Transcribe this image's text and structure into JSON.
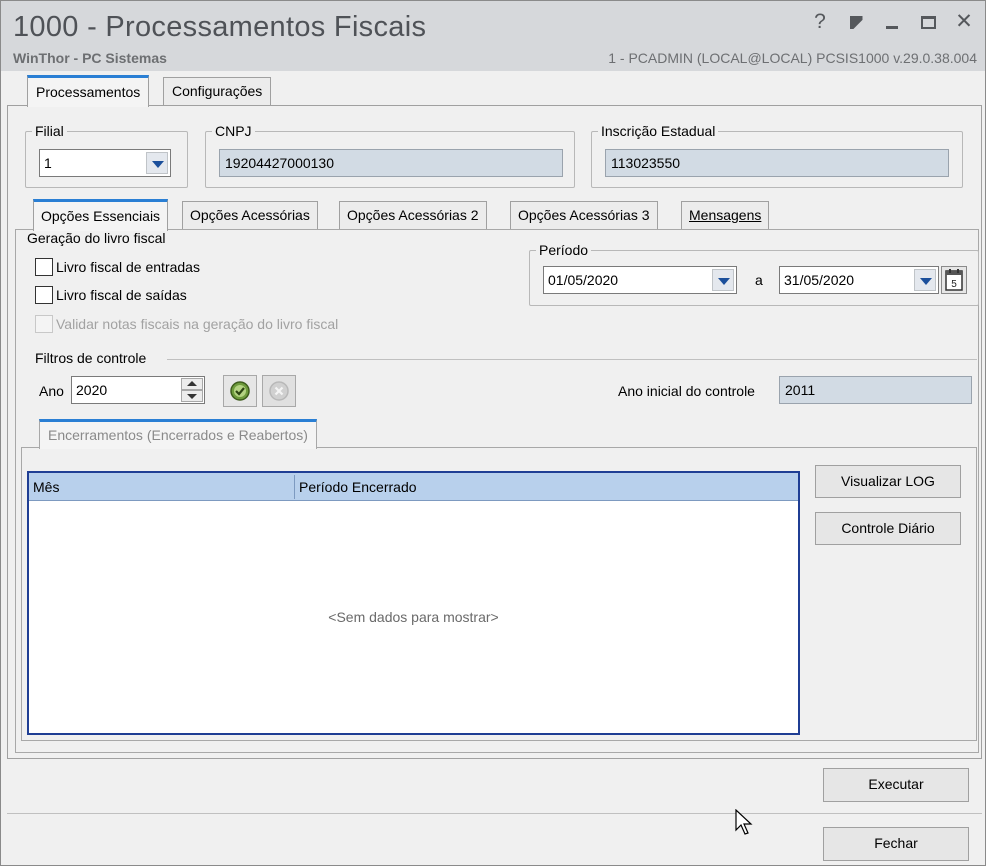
{
  "window": {
    "title": "1000 - Processamentos Fiscais",
    "app_name": "WinThor - PC Sistemas",
    "session_info": "1 - PCADMIN (LOCAL@LOCAL)   PCSIS1000  v.29.0.38.004",
    "controls": {
      "help": "?"
    }
  },
  "top_tabs": [
    {
      "label": "Processamentos",
      "active": true
    },
    {
      "label": "Configurações",
      "active": false
    }
  ],
  "filial": {
    "legend": "Filial",
    "value": "1"
  },
  "cnpj": {
    "legend": "CNPJ",
    "value": "19204427000130"
  },
  "inscricao": {
    "legend": "Inscrição Estadual",
    "value": "113023550"
  },
  "inner_tabs": [
    {
      "label": "Opções Essenciais",
      "active": true
    },
    {
      "label": "Opções Acessórias",
      "active": false
    },
    {
      "label": "Opções Acessórias 2",
      "active": false
    },
    {
      "label": "Opções Acessórias 3",
      "active": false
    },
    {
      "label": "Mensagens",
      "active": false
    }
  ],
  "geracao": {
    "title": "Geração do livro fiscal",
    "options": [
      {
        "label": "Livro fiscal de entradas",
        "checked": false,
        "enabled": true
      },
      {
        "label": "Livro fiscal de saídas",
        "checked": false,
        "enabled": true
      },
      {
        "label": "Validar notas fiscais na geração do livro fiscal",
        "checked": false,
        "enabled": false
      }
    ]
  },
  "periodo": {
    "legend": "Período",
    "start": "01/05/2020",
    "separator": "a",
    "end": "31/05/2020"
  },
  "filtros": {
    "title": "Filtros de controle",
    "ano_label": "Ano",
    "ano_value": "2020",
    "ano_inicial_label": "Ano inicial do controle",
    "ano_inicial_value": "2011"
  },
  "encerramentos_tab": {
    "label": "Encerramentos (Encerrados e Reabertos)"
  },
  "grid": {
    "columns": [
      "Mês",
      "Período Encerrado"
    ],
    "empty_text": "<Sem dados para mostrar>"
  },
  "side_buttons": {
    "log": "Visualizar LOG",
    "controle": "Controle Diário"
  },
  "footer": {
    "executar": "Executar",
    "fechar": "Fechar"
  },
  "colors": {
    "accent": "#2a7fd4",
    "grid_border": "#1f3e94",
    "readonly_bg": "#d2dbe4"
  }
}
